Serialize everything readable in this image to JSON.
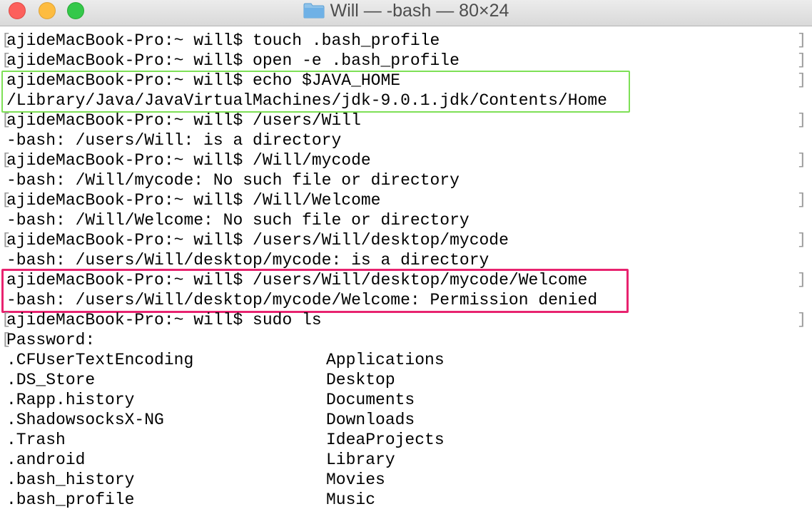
{
  "window": {
    "title": "Will — -bash — 80×24",
    "folder_icon": "folder-icon"
  },
  "terminal": {
    "lines": [
      {
        "text": "ajideMacBook-Pro:~ will$ touch .bash_profile",
        "bracket": true
      },
      {
        "text": "ajideMacBook-Pro:~ will$ open -e .bash_profile",
        "bracket": true
      },
      {
        "text": "ajideMacBook-Pro:~ will$ echo $JAVA_HOME",
        "bracket": false
      },
      {
        "text": "/Library/Java/JavaVirtualMachines/jdk-9.0.1.jdk/Contents/Home",
        "bracket": false
      },
      {
        "text": "ajideMacBook-Pro:~ will$ /users/Will",
        "bracket": true
      },
      {
        "text": "-bash: /users/Will: is a directory",
        "bracket": false
      },
      {
        "text": "ajideMacBook-Pro:~ will$ /Will/mycode",
        "bracket": true
      },
      {
        "text": "-bash: /Will/mycode: No such file or directory",
        "bracket": false
      },
      {
        "text": "ajideMacBook-Pro:~ will$ /Will/Welcome",
        "bracket": true
      },
      {
        "text": "-bash: /Will/Welcome: No such file or directory",
        "bracket": false
      },
      {
        "text": "ajideMacBook-Pro:~ will$ /users/Will/desktop/mycode",
        "bracket": true
      },
      {
        "text": "-bash: /users/Will/desktop/mycode: is a directory",
        "bracket": false
      },
      {
        "text": "ajideMacBook-Pro:~ will$ /users/Will/desktop/mycode/Welcome",
        "bracket": false
      },
      {
        "text": "-bash: /users/Will/desktop/mycode/Welcome: Permission denied",
        "bracket": false
      },
      {
        "text": "ajideMacBook-Pro:~ will$ sudo ls",
        "bracket": true
      },
      {
        "text": "Password:",
        "bracket": true
      }
    ],
    "listing_left": [
      ".CFUserTextEncoding",
      ".DS_Store",
      ".Rapp.history",
      ".ShadowsocksX-NG",
      ".Trash",
      ".android",
      ".bash_history",
      ".bash_profile"
    ],
    "listing_right": [
      "Applications",
      "Desktop",
      "Documents",
      "Downloads",
      "IdeaProjects",
      "Library",
      "Movies",
      "Music"
    ],
    "right_bracket_rows": [
      0,
      1,
      2,
      4,
      6,
      8,
      10,
      12,
      14
    ]
  },
  "colors": {
    "green_highlight": "#7ee056",
    "pink_highlight": "#e8236f",
    "close": "#fc605c",
    "minimize": "#fdbc40",
    "zoom": "#34c84a"
  }
}
